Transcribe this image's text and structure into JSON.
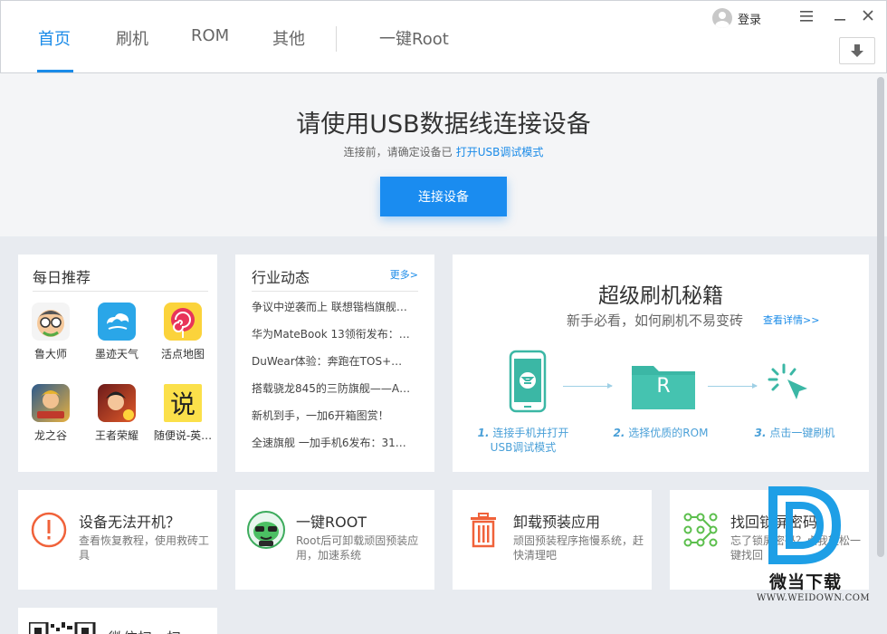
{
  "tabs": [
    {
      "label": "首页"
    },
    {
      "label": "刷机"
    },
    {
      "label": "ROM"
    },
    {
      "label": "其他"
    },
    {
      "label": "一键Root"
    }
  ],
  "header": {
    "login_label": "登录",
    "menu_icon": "hamburger-icon",
    "minimize_icon": "minimize-icon",
    "close_icon": "close-icon",
    "download_icon": "download-icon"
  },
  "connect": {
    "title": "请使用USB数据线连接设备",
    "hint": "连接前，请确定设备已",
    "hint_link": "打开USB调试模式",
    "button": "连接设备"
  },
  "daily": {
    "title": "每日推荐",
    "apps": [
      {
        "name": "鲁大师"
      },
      {
        "name": "墨迹天气"
      },
      {
        "name": "活点地图"
      },
      {
        "name": "龙之谷"
      },
      {
        "name": "王者荣耀"
      },
      {
        "name": "随便说-英…"
      }
    ]
  },
  "news": {
    "title": "行业动态",
    "more": "更多>",
    "items": [
      "争议中逆袭而上 联想锴档旗舰…",
      "华为MateBook 13领衔发布：…",
      "DuWear体验：奔跑在TOS+…",
      "搭载骁龙845的三防旗舰——A…",
      "新机到手，一加6开箱图赏！",
      "全速旗舰 一加手机6发布：31…"
    ]
  },
  "guide": {
    "title": "超级刷机秘籍",
    "subtitle": "新手必看，如何刷机不易变砖",
    "link": "查看详情>>",
    "steps": [
      {
        "num": "1.",
        "text1": "连接手机并打开",
        "text2": "USB调试模式"
      },
      {
        "num": "2.",
        "text1": "选择优质的ROM",
        "text2": ""
      },
      {
        "num": "3.",
        "text1": "点击一键刷机",
        "text2": ""
      }
    ],
    "folder_letter": "R"
  },
  "cards": [
    {
      "title": "设备无法开机？",
      "desc": "查看恢复教程，使用救砖工具"
    },
    {
      "title": "一键ROOT",
      "desc": "Root后可卸载顽固预装应用，加速系统"
    },
    {
      "title": "卸载预装应用",
      "desc": "顽固预装程序拖慢系统，赶快清理吧"
    },
    {
      "title": "找回锁屏密码",
      "desc": "忘了锁屏密码？点我轻松一键找回"
    }
  ],
  "qr": {
    "title": "微信扫一扫"
  },
  "watermark": {
    "cn": "微当下载",
    "en": "WWW.WEIDOWN.COM"
  },
  "colors": {
    "accent": "#1a8be8",
    "guide_green": "#3bb7a5",
    "danger": "#f0623a"
  }
}
